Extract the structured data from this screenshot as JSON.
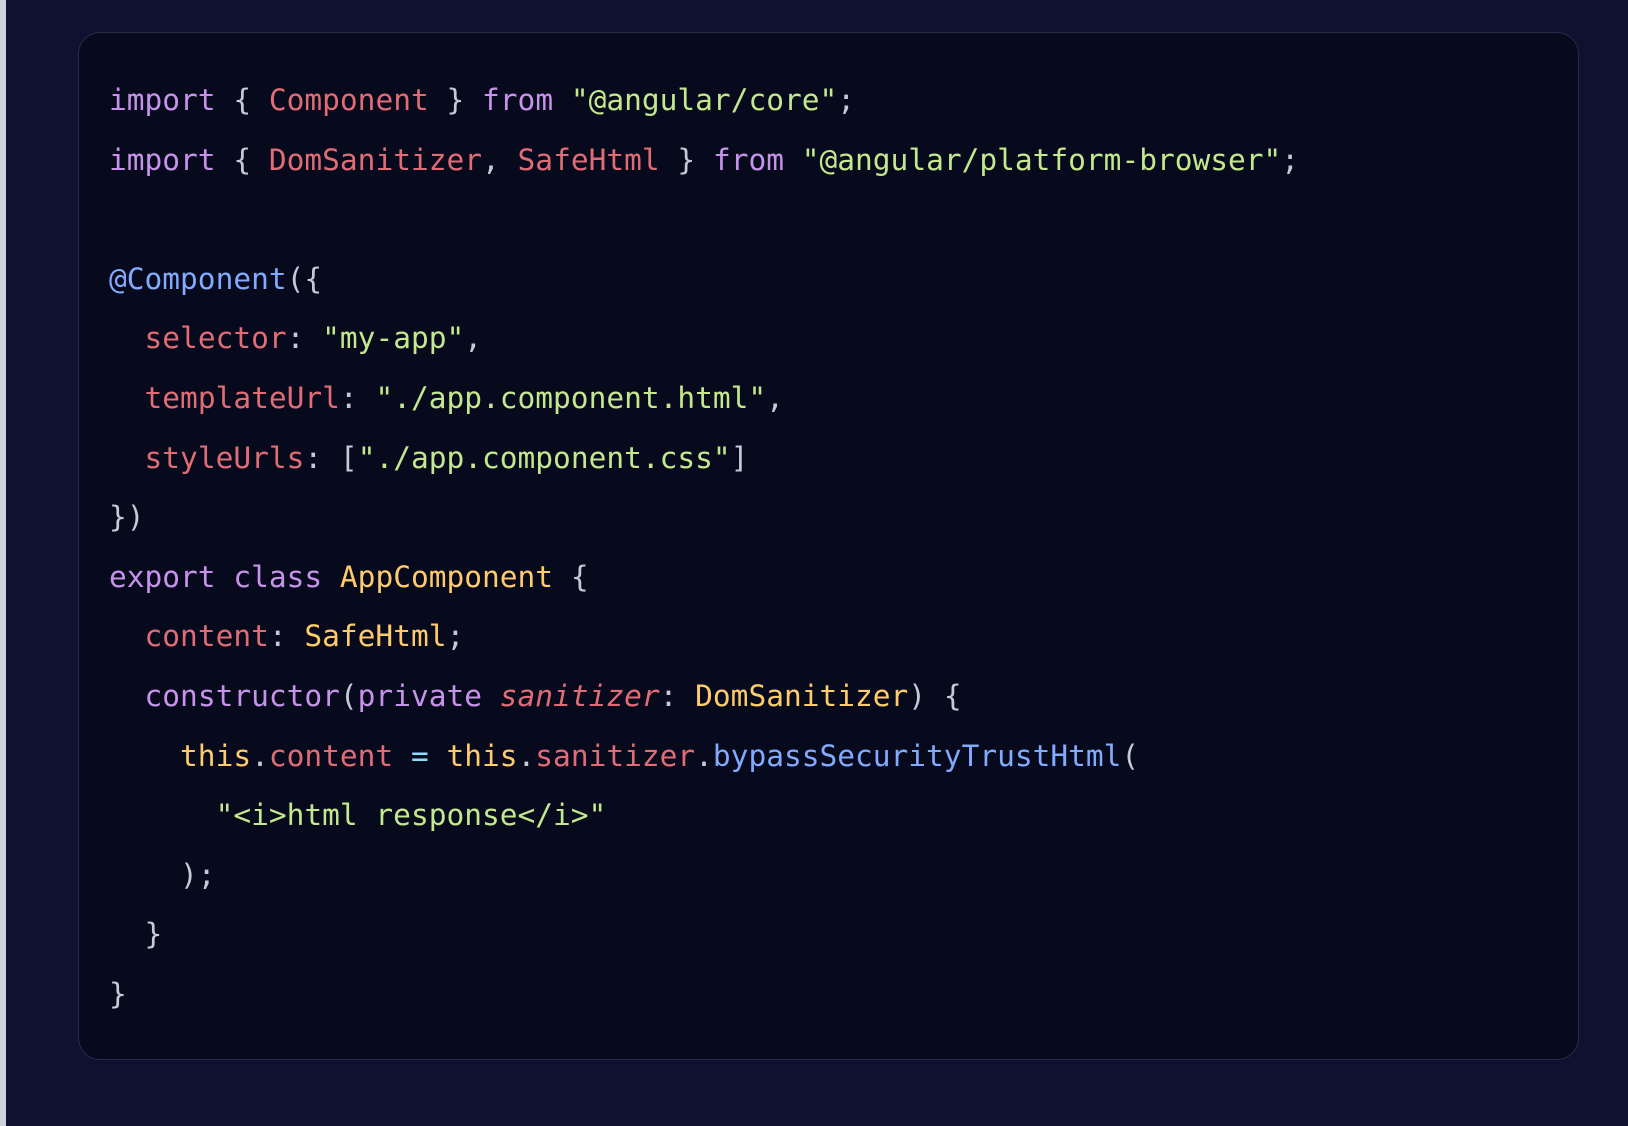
{
  "page": {
    "background": "#0e1130",
    "edge_strip_color": "#cfd2da"
  },
  "code_block": {
    "background": "#070a1c",
    "border_color": "#2a2b45",
    "language": "typescript",
    "plain_text": "import { Component } from \"@angular/core\";\nimport { DomSanitizer, SafeHtml } from \"@angular/platform-browser\";\n\n@Component({\n  selector: \"my-app\",\n  templateUrl: \"./app.component.html\",\n  styleUrls: [\"./app.component.css\"]\n})\nexport class AppComponent {\n  content: SafeHtml;\n  constructor(private sanitizer: DomSanitizer) {\n    this.content = this.sanitizer.bypassSecurityTrustHtml(\n      \"<i>html response</i>\"\n    );\n  }\n}",
    "palette": {
      "keyword": "#c792ea",
      "variable": "#e06c75",
      "string": "#c3e88d",
      "punctuation": "#c5cad6",
      "decorator": "#82aaff",
      "type": "#ffcb6b",
      "operator": "#89ddff"
    },
    "lines": [
      {
        "id": "line-1",
        "tokens": [
          {
            "text": "import",
            "cls": "t-kw"
          },
          {
            "text": " ",
            "cls": "t-punct"
          },
          {
            "text": "{",
            "cls": "t-punct"
          },
          {
            "text": " ",
            "cls": "t-punct"
          },
          {
            "text": "Component",
            "cls": "t-var"
          },
          {
            "text": " ",
            "cls": "t-punct"
          },
          {
            "text": "}",
            "cls": "t-punct"
          },
          {
            "text": " ",
            "cls": "t-punct"
          },
          {
            "text": "from",
            "cls": "t-kw"
          },
          {
            "text": " ",
            "cls": "t-punct"
          },
          {
            "text": "\"@angular/core\"",
            "cls": "t-str"
          },
          {
            "text": ";",
            "cls": "t-punct"
          }
        ]
      },
      {
        "id": "line-2",
        "tokens": [
          {
            "text": "import",
            "cls": "t-kw"
          },
          {
            "text": " ",
            "cls": "t-punct"
          },
          {
            "text": "{",
            "cls": "t-punct"
          },
          {
            "text": " ",
            "cls": "t-punct"
          },
          {
            "text": "DomSanitizer",
            "cls": "t-var"
          },
          {
            "text": ",",
            "cls": "t-punct"
          },
          {
            "text": " ",
            "cls": "t-punct"
          },
          {
            "text": "SafeHtml",
            "cls": "t-var"
          },
          {
            "text": " ",
            "cls": "t-punct"
          },
          {
            "text": "}",
            "cls": "t-punct"
          },
          {
            "text": " ",
            "cls": "t-punct"
          },
          {
            "text": "from",
            "cls": "t-kw"
          },
          {
            "text": " ",
            "cls": "t-punct"
          },
          {
            "text": "\"@angular/platform-browser\"",
            "cls": "t-str"
          },
          {
            "text": ";",
            "cls": "t-punct"
          }
        ]
      },
      {
        "id": "line-3",
        "tokens": [
          {
            "text": " ",
            "cls": "t-punct"
          }
        ]
      },
      {
        "id": "line-4",
        "tokens": [
          {
            "text": "@Component",
            "cls": "t-deco"
          },
          {
            "text": "({",
            "cls": "t-punct"
          }
        ]
      },
      {
        "id": "line-5",
        "tokens": [
          {
            "text": "  ",
            "cls": "t-punct"
          },
          {
            "text": "selector",
            "cls": "t-var"
          },
          {
            "text": ": ",
            "cls": "t-punct"
          },
          {
            "text": "\"my-app\"",
            "cls": "t-str"
          },
          {
            "text": ",",
            "cls": "t-punct"
          }
        ]
      },
      {
        "id": "line-6",
        "tokens": [
          {
            "text": "  ",
            "cls": "t-punct"
          },
          {
            "text": "templateUrl",
            "cls": "t-var"
          },
          {
            "text": ": ",
            "cls": "t-punct"
          },
          {
            "text": "\"./app.component.html\"",
            "cls": "t-str"
          },
          {
            "text": ",",
            "cls": "t-punct"
          }
        ]
      },
      {
        "id": "line-7",
        "tokens": [
          {
            "text": "  ",
            "cls": "t-punct"
          },
          {
            "text": "styleUrls",
            "cls": "t-var"
          },
          {
            "text": ": [",
            "cls": "t-punct"
          },
          {
            "text": "\"./app.component.css\"",
            "cls": "t-str"
          },
          {
            "text": "]",
            "cls": "t-punct"
          }
        ]
      },
      {
        "id": "line-8",
        "tokens": [
          {
            "text": "})",
            "cls": "t-punct"
          }
        ]
      },
      {
        "id": "line-9",
        "tokens": [
          {
            "text": "export",
            "cls": "t-kw"
          },
          {
            "text": " ",
            "cls": "t-punct"
          },
          {
            "text": "class",
            "cls": "t-kw"
          },
          {
            "text": " ",
            "cls": "t-punct"
          },
          {
            "text": "AppComponent",
            "cls": "t-type"
          },
          {
            "text": " ",
            "cls": "t-punct"
          },
          {
            "text": "{",
            "cls": "t-punct"
          }
        ]
      },
      {
        "id": "line-10",
        "tokens": [
          {
            "text": "  ",
            "cls": "t-punct"
          },
          {
            "text": "content",
            "cls": "t-var"
          },
          {
            "text": ": ",
            "cls": "t-punct"
          },
          {
            "text": "SafeHtml",
            "cls": "t-type"
          },
          {
            "text": ";",
            "cls": "t-punct"
          }
        ]
      },
      {
        "id": "line-11",
        "tokens": [
          {
            "text": "  ",
            "cls": "t-punct"
          },
          {
            "text": "constructor",
            "cls": "t-kw"
          },
          {
            "text": "(",
            "cls": "t-punct"
          },
          {
            "text": "private",
            "cls": "t-kw"
          },
          {
            "text": " ",
            "cls": "t-punct"
          },
          {
            "text": "sanitizer",
            "cls": "t-param"
          },
          {
            "text": ": ",
            "cls": "t-punct"
          },
          {
            "text": "DomSanitizer",
            "cls": "t-type"
          },
          {
            "text": ") ",
            "cls": "t-punct"
          },
          {
            "text": "{",
            "cls": "t-punct"
          }
        ]
      },
      {
        "id": "line-12",
        "tokens": [
          {
            "text": "    ",
            "cls": "t-punct"
          },
          {
            "text": "this",
            "cls": "t-type"
          },
          {
            "text": ".",
            "cls": "t-punct"
          },
          {
            "text": "content",
            "cls": "t-var"
          },
          {
            "text": " ",
            "cls": "t-punct"
          },
          {
            "text": "=",
            "cls": "t-op"
          },
          {
            "text": " ",
            "cls": "t-punct"
          },
          {
            "text": "this",
            "cls": "t-type"
          },
          {
            "text": ".",
            "cls": "t-punct"
          },
          {
            "text": "sanitizer",
            "cls": "t-var"
          },
          {
            "text": ".",
            "cls": "t-punct"
          },
          {
            "text": "bypassSecurityTrustHtml",
            "cls": "t-deco"
          },
          {
            "text": "(",
            "cls": "t-punct"
          }
        ]
      },
      {
        "id": "line-13",
        "tokens": [
          {
            "text": "      ",
            "cls": "t-punct"
          },
          {
            "text": "\"<i>html response</i>\"",
            "cls": "t-str"
          }
        ]
      },
      {
        "id": "line-14",
        "tokens": [
          {
            "text": "    ",
            "cls": "t-punct"
          },
          {
            "text": ");",
            "cls": "t-punct"
          }
        ]
      },
      {
        "id": "line-15",
        "tokens": [
          {
            "text": "  ",
            "cls": "t-punct"
          },
          {
            "text": "}",
            "cls": "t-punct"
          }
        ]
      },
      {
        "id": "line-16",
        "tokens": [
          {
            "text": "}",
            "cls": "t-punct"
          }
        ]
      }
    ]
  }
}
